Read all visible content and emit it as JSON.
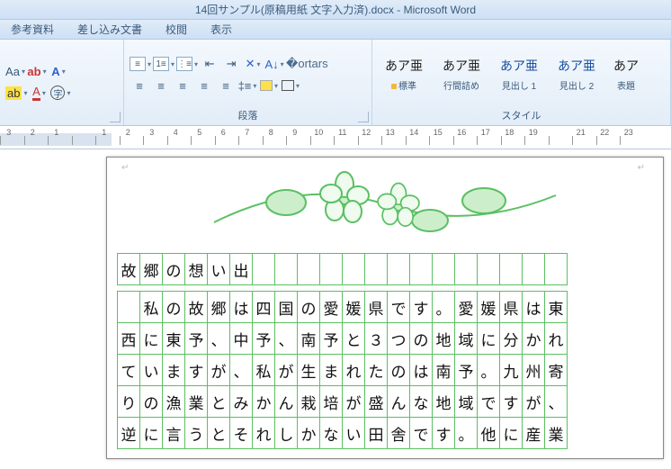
{
  "title": "14回サンプル(原稿用紙 文字入力済).docx - Microsoft Word",
  "menu": {
    "items": [
      "参考資料",
      "差し込み文書",
      "校閲",
      "表示"
    ]
  },
  "ribbon": {
    "group_font": "",
    "group_para": "段落",
    "group_style": "スタイル",
    "styles": [
      {
        "sample": "あア亜",
        "name": "標準"
      },
      {
        "sample": "あア亜",
        "name": "行間詰め"
      },
      {
        "sample": "あア亜",
        "name": "見出し 1"
      },
      {
        "sample": "あア亜",
        "name": "見出し 2"
      },
      {
        "sample": "あア",
        "name": "表題"
      }
    ]
  },
  "ruler": {
    "start": 3,
    "ticks": [
      3,
      2,
      1,
      "",
      1,
      2,
      3,
      4,
      5,
      6,
      7,
      8,
      9,
      10,
      11,
      12,
      13,
      14,
      15,
      16,
      17,
      18,
      19,
      "",
      21,
      22,
      23
    ]
  },
  "doc": {
    "lines": [
      [
        "故",
        "郷",
        "の",
        "想",
        "い",
        "出",
        "",
        "",
        "",
        "",
        "",
        "",
        "",
        "",
        "",
        "",
        "",
        "",
        "",
        "",
        "",
        "",
        ""
      ],
      [
        "",
        "私",
        "の",
        "故",
        "郷",
        "は",
        "四",
        "国",
        "の",
        "愛",
        "媛",
        "県",
        "で",
        "す",
        "。",
        "愛",
        "媛",
        "県",
        "は",
        "東",
        "",
        "",
        ""
      ],
      [
        "西",
        "に",
        "東",
        "予",
        "、",
        "中",
        "予",
        "、",
        "南",
        "予",
        "と",
        "３",
        "つ",
        "の",
        "地",
        "域",
        "に",
        "分",
        "か",
        "れ",
        "",
        "",
        ""
      ],
      [
        "て",
        "い",
        "ま",
        "す",
        "が",
        "、",
        "私",
        "が",
        "生",
        "ま",
        "れ",
        "た",
        "の",
        "は",
        "南",
        "予",
        "。",
        "九",
        "州",
        "寄",
        "",
        "",
        ""
      ],
      [
        "り",
        "の",
        "漁",
        "業",
        "と",
        "み",
        "か",
        "ん",
        "栽",
        "培",
        "が",
        "盛",
        "ん",
        "な",
        "地",
        "域",
        "で",
        "す",
        "が",
        "、",
        "",
        "",
        ""
      ],
      [
        "逆",
        "に",
        "言",
        "う",
        "と",
        "そ",
        "れ",
        "し",
        "か",
        "な",
        "い",
        "田",
        "舎",
        "で",
        "す",
        "。",
        "他",
        "に",
        "産",
        "業",
        "",
        "",
        ""
      ]
    ]
  }
}
